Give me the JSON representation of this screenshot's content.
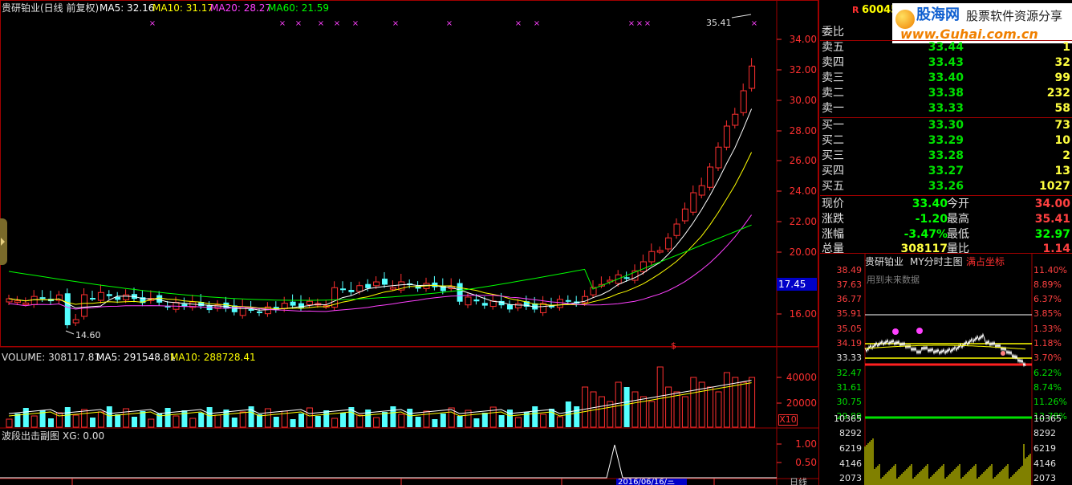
{
  "chart": {
    "title": "贵研铂业(日线 前复权)",
    "ma_labels": [
      {
        "text": "MA5: 32.16",
        "color": "#ffffff"
      },
      {
        "text": "MA10: 31.17",
        "color": "#ffff00"
      },
      {
        "text": "MA20: 28.27",
        "color": "#ff40ff"
      },
      {
        "text": "MA60: 21.59",
        "color": "#00ff00"
      }
    ],
    "high_label": "35.41",
    "low_label": "14.60",
    "price_ticks": [
      "34.00",
      "32.00",
      "30.00",
      "28.00",
      "26.00",
      "24.00",
      "22.00",
      "20.00",
      "16.00"
    ],
    "current_price_badge": "17.45",
    "dollar_marker": "$"
  },
  "volume_panel": {
    "label": "VOLUME: 308117.81",
    "ma5": "MA5: 291548.81",
    "ma10": "MA10: 288728.41",
    "ticks": [
      "40000",
      "20000"
    ],
    "unit": "X10"
  },
  "sub_panel": {
    "label": "波段出击副图",
    "xg": "XG: 0.00",
    "ticks": [
      "1.00",
      "0.50"
    ]
  },
  "bottom_axis": {
    "date_badge": "2016/06/16/三",
    "right_label": "日线"
  },
  "right_header": {
    "r_marker": "R",
    "code": "60045",
    "logo_main": "股海网",
    "logo_tagline": "股票软件资源分享",
    "logo_url": "www.Guhai.com.cn"
  },
  "order_book": {
    "weibi_label": "委比",
    "asks": [
      {
        "label": "卖五",
        "price": "33.44",
        "vol": "1"
      },
      {
        "label": "卖四",
        "price": "33.43",
        "vol": "32"
      },
      {
        "label": "卖三",
        "price": "33.40",
        "vol": "99"
      },
      {
        "label": "卖二",
        "price": "33.38",
        "vol": "232"
      },
      {
        "label": "卖一",
        "price": "33.33",
        "vol": "58"
      }
    ],
    "bids": [
      {
        "label": "买一",
        "price": "33.30",
        "vol": "73"
      },
      {
        "label": "买二",
        "price": "33.29",
        "vol": "10"
      },
      {
        "label": "买三",
        "price": "33.28",
        "vol": "2"
      },
      {
        "label": "买四",
        "price": "33.27",
        "vol": "13"
      },
      {
        "label": "买五",
        "price": "33.26",
        "vol": "1027"
      }
    ]
  },
  "quote": {
    "rows": [
      {
        "l1": "现价",
        "v1": "33.40",
        "c1": "#00ff00",
        "l2": "今开",
        "v2": "34.00",
        "c2": "#ff4040"
      },
      {
        "l1": "涨跌",
        "v1": "-1.20",
        "c1": "#00ff00",
        "l2": "最高",
        "v2": "35.41",
        "c2": "#ff4040"
      },
      {
        "l1": "涨幅",
        "v1": "-3.47%",
        "c1": "#00ff00",
        "l2": "最低",
        "v2": "32.97",
        "c2": "#00ff00"
      },
      {
        "l1": "总量",
        "v1": "308117",
        "c1": "#ffff40",
        "l2": "量比",
        "v2": "1.14",
        "c2": "#ff4040"
      }
    ]
  },
  "intraday": {
    "stock": "贵研铂业",
    "indicator": "MY分时主图",
    "mode": "满占坐标",
    "future_data": "用到未来数据",
    "left_ticks": [
      "38.49",
      "37.63",
      "36.77",
      "35.91",
      "35.05",
      "34.19",
      "33.33",
      "32.47",
      "31.61",
      "30.75",
      "29.89"
    ],
    "right_ticks": [
      "11.40%",
      "8.89%",
      "6.37%",
      "3.85%",
      "1.33%",
      "1.18%",
      "3.70%",
      "6.22%",
      "8.74%",
      "11.26%",
      "13.78%"
    ],
    "vol_left_ticks": [
      "10365",
      "8292",
      "6219",
      "4146",
      "2073"
    ],
    "vol_right_ticks": [
      "10365",
      "8292",
      "6219",
      "4146",
      "2073"
    ]
  }
}
